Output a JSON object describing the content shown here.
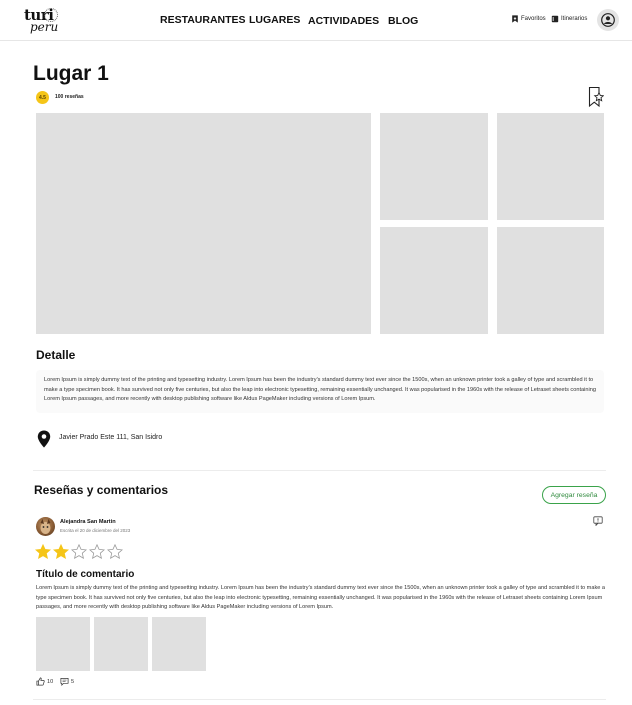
{
  "brand": {
    "logo_main": "turi",
    "logo_sub": "peru"
  },
  "nav": {
    "items": [
      "RESTAURANTES",
      "LUGARES",
      "ACTIVIDADES",
      "BLOG"
    ]
  },
  "header_links": {
    "favorites": "Favoritos",
    "itineraries": "Itinerarios"
  },
  "place": {
    "title": "Lugar 1",
    "rating": "4.5",
    "reviews_count": "100 reseñas"
  },
  "detail": {
    "heading": "Detalle",
    "text": "Lorem Ipsum is simply dummy text of the printing and typesetting industry. Lorem Ipsum has been the industry's standard dummy text ever since the 1500s, when an unknown printer took a galley of type and scrambled it to make a type specimen book. It has survived not only five centuries, but also the leap into electronic typesetting, remaining essentially unchanged. It was popularised in the 1960s with the release of Letraset sheets containing Lorem Ipsum passages, and more recently with desktop publishing software like Aldus PageMaker including versions of Lorem Ipsum.",
    "address": "Javier Prado Este 111, San Isidro"
  },
  "reviews": {
    "heading": "Reseñas y comentarios",
    "add_label": "Agregar reseña",
    "items": [
      {
        "author": "Alejandra San Martin",
        "date": "Escrita el 20 de diciembre del 2023",
        "stars": 2,
        "max_stars": 5,
        "title": "Título de comentario",
        "body": "Lorem Ipsum is simply dummy text of the printing and typesetting industry. Lorem Ipsum has been the industry's standard dummy text ever since the 1500s, when an unknown printer took a galley of type and scrambled it to make a type specimen book. It has survived not only five centuries, but also the leap into electronic typesetting, remaining essentially unchanged. It was popularised in the 1960s with the release of Letraset sheets containing Lorem Ipsum passages, and more recently with desktop publishing software like Aldus PageMaker including versions of Lorem Ipsum.",
        "likes": "10",
        "comments": "5"
      }
    ]
  },
  "colors": {
    "accent_green": "#3aa34a",
    "star_yellow": "#f5c518",
    "placeholder_gray": "#e0e0e0"
  },
  "icons": [
    "bookmark-star-icon",
    "location-pin-icon",
    "star-icon",
    "thumbs-up-icon",
    "comment-icon",
    "report-icon",
    "user-icon",
    "book-icon"
  ]
}
